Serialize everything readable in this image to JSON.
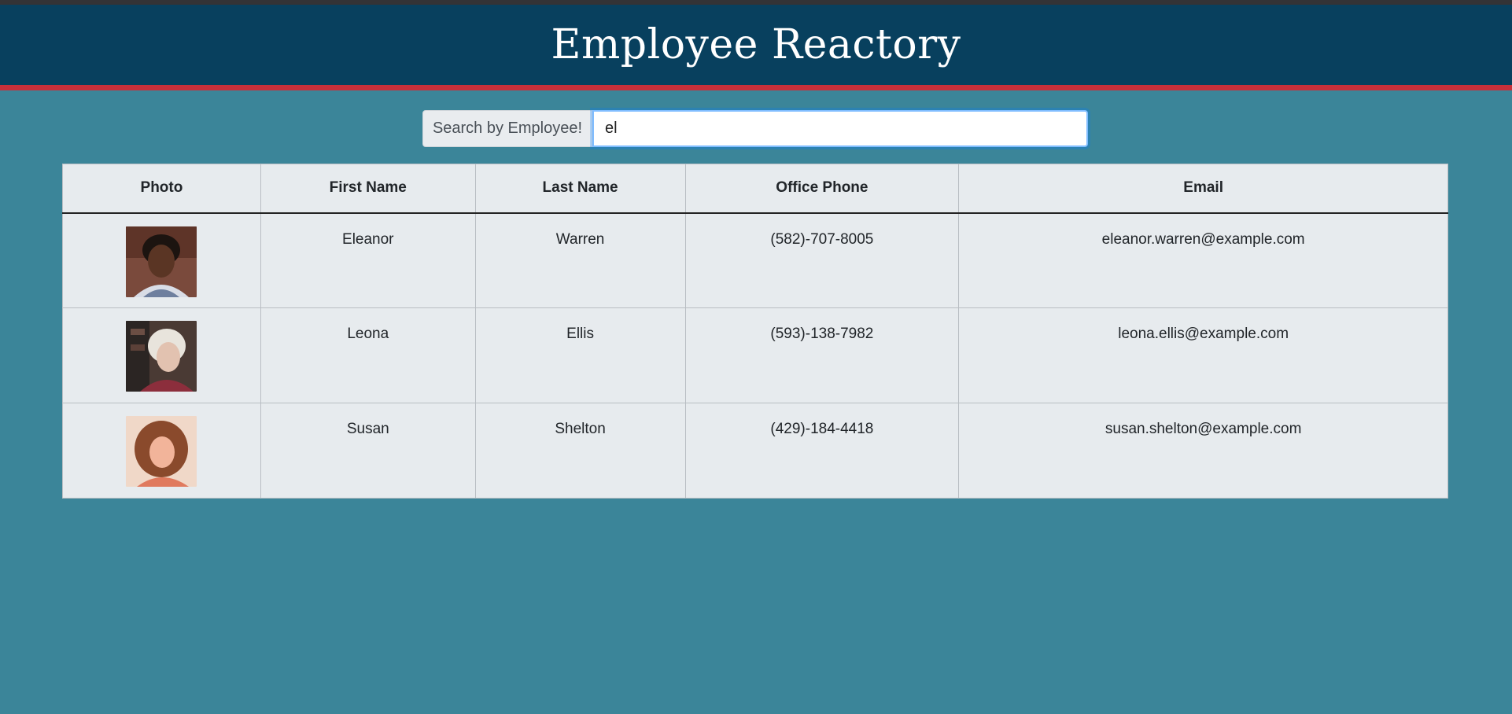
{
  "app": {
    "title": "Employee Reactory"
  },
  "search": {
    "label": "Search by Employee!",
    "value": "el"
  },
  "table": {
    "headers": [
      "Photo",
      "First Name",
      "Last Name",
      "Office Phone",
      "Email"
    ],
    "rows": [
      {
        "first": "Eleanor",
        "last": "Warren",
        "phone": "(582)-707-8005",
        "email": "eleanor.warren@example.com"
      },
      {
        "first": "Leona",
        "last": "Ellis",
        "phone": "(593)-138-7982",
        "email": "leona.ellis@example.com"
      },
      {
        "first": "Susan",
        "last": "Shelton",
        "phone": "(429)-184-4418",
        "email": "susan.shelton@example.com"
      }
    ]
  },
  "colors": {
    "header_bg": "#08405e",
    "accent_red": "#c8303a",
    "page_bg": "#3b8599",
    "table_bg": "#e7ebee"
  }
}
